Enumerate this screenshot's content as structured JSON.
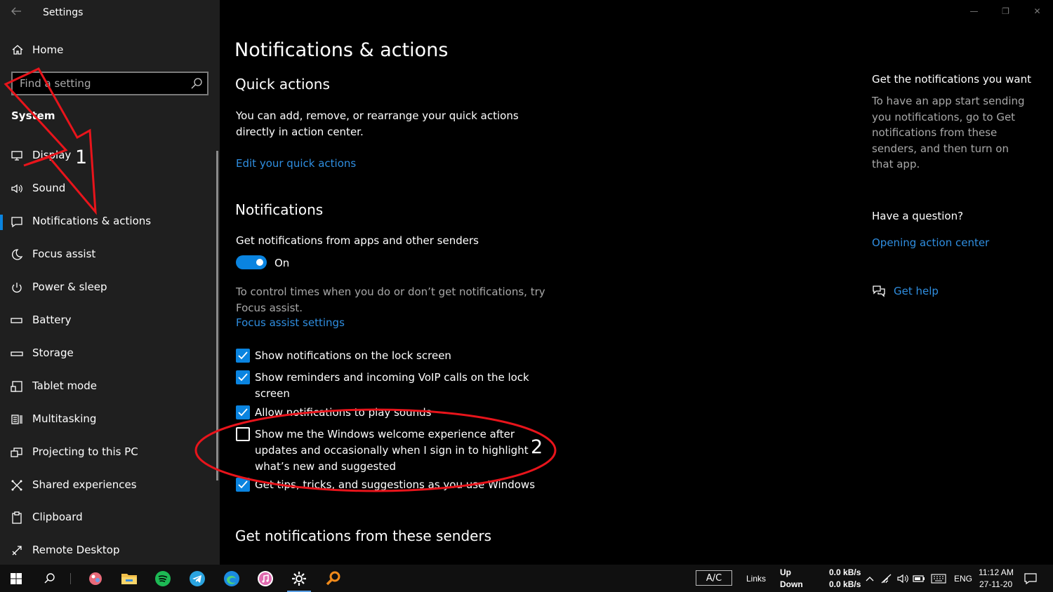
{
  "window": {
    "title": "Settings",
    "controls": [
      "—",
      "❐",
      "✕"
    ]
  },
  "sidebar": {
    "home_label": "Home",
    "search_placeholder": "Find a setting",
    "section": "System",
    "items": [
      {
        "label": "Display",
        "icon": "monitor-icon"
      },
      {
        "label": "Sound",
        "icon": "speaker-icon"
      },
      {
        "label": "Notifications & actions",
        "icon": "notification-icon",
        "selected": true
      },
      {
        "label": "Focus assist",
        "icon": "moon-icon"
      },
      {
        "label": "Power & sleep",
        "icon": "power-icon"
      },
      {
        "label": "Battery",
        "icon": "battery-icon"
      },
      {
        "label": "Storage",
        "icon": "storage-icon"
      },
      {
        "label": "Tablet mode",
        "icon": "tablet-icon"
      },
      {
        "label": "Multitasking",
        "icon": "multitasking-icon"
      },
      {
        "label": "Projecting to this PC",
        "icon": "projector-icon"
      },
      {
        "label": "Shared experiences",
        "icon": "shared-icon"
      },
      {
        "label": "Clipboard",
        "icon": "clipboard-icon"
      },
      {
        "label": "Remote Desktop",
        "icon": "remote-icon"
      }
    ]
  },
  "main": {
    "title": "Notifications & actions",
    "quick_actions": {
      "heading": "Quick actions",
      "desc_line1": "You can add, remove, or rearrange your quick actions",
      "desc_line2": "directly in action center.",
      "link": "Edit your quick actions"
    },
    "notifications": {
      "heading": "Notifications",
      "toggle_label": "Get notifications from apps and other senders",
      "toggle_state": "On",
      "focus_line1": "To control times when you do or don’t get notifications, try",
      "focus_line2": "Focus assist.",
      "focus_link": "Focus assist settings",
      "checkboxes": [
        {
          "label": "Show notifications on the lock screen",
          "checked": true
        },
        {
          "label": "Show reminders and incoming VoIP calls on the lock screen",
          "checked": true
        },
        {
          "label": "Allow notifications to play sounds",
          "checked": true
        },
        {
          "label": "Show me the Windows welcome experience after updates and occasionally when I sign in to highlight what’s new and suggested",
          "checked": false
        },
        {
          "label": "Get tips, tricks, and suggestions as you use Windows",
          "checked": true
        }
      ]
    },
    "senders_heading": "Get notifications from these senders"
  },
  "right": {
    "heading1": "Get the notifications you want",
    "para1": "To have an app start sending you notifications, go to Get notifications from these senders, and then turn on that app.",
    "heading2": "Have a question?",
    "link1": "Opening action center",
    "help_link": "Get help"
  },
  "annotations": {
    "n1": "1",
    "n2": "2",
    "color": "#e8141b"
  },
  "taskbar": {
    "ac": "A/C",
    "links": "Links",
    "up": "Up",
    "down": "Down",
    "up_speed": "0.0 kB/s",
    "down_speed": "0.0 kB/s",
    "lang": "ENG",
    "time": "11:12 AM",
    "date": "27-11-20"
  },
  "colors": {
    "accent": "#0a84e0",
    "link": "#2f8ee0",
    "sidebar": "#1f1f1f"
  }
}
